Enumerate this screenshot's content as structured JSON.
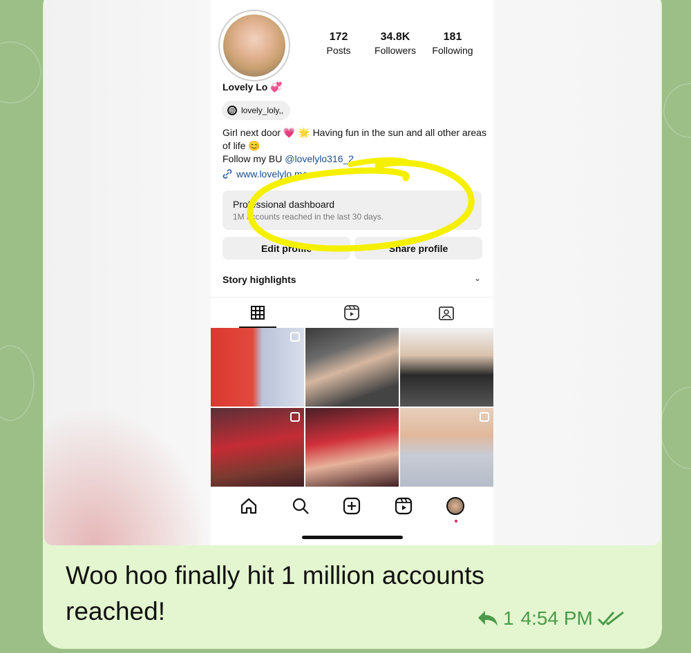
{
  "profile": {
    "stats": [
      {
        "value": "172",
        "label": "Posts"
      },
      {
        "value": "34.8K",
        "label": "Followers"
      },
      {
        "value": "181",
        "label": "Following"
      }
    ],
    "name": "Lovely Lo",
    "name_emoji": "💞",
    "threads_handle": "lovely_loly,,",
    "bio_line1": "Girl next door 💗 🌟 Having fun in the sun and all other areas of life 😊",
    "bio_line2_prefix": "Follow my BU ",
    "bio_mention": "@lovelylo316_2",
    "link": "www.lovelylo.me"
  },
  "dashboard": {
    "title": "Professional dashboard",
    "subtitle": "1M accounts reached in the last 30 days."
  },
  "buttons": {
    "edit_profile": "Edit profile",
    "share_profile": "Share profile"
  },
  "highlights_label": "Story highlights",
  "message": {
    "text": "Woo hoo finally hit 1 million accounts reached!",
    "reply_count": "1",
    "time": "4:54 PM"
  },
  "colors": {
    "chat_background": "#9bbf86",
    "bubble": "#e3f6cf",
    "meta": "#4a9a4a",
    "highlight_scribble": "#f5f000"
  }
}
